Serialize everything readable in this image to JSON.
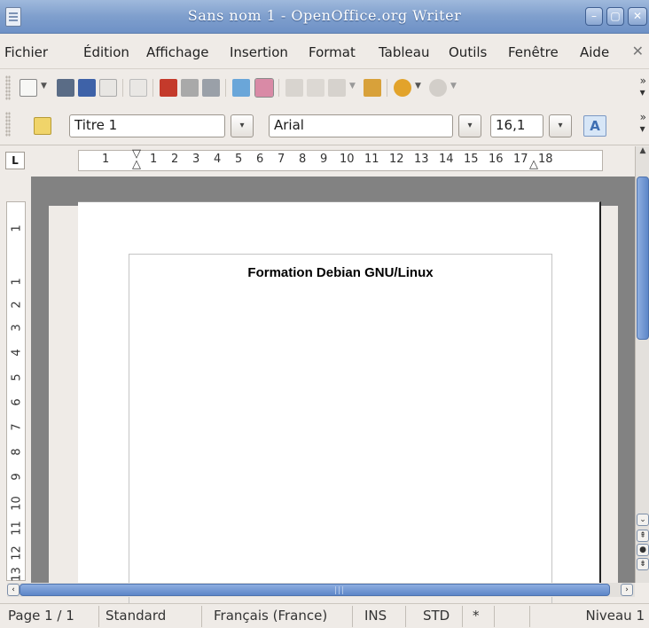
{
  "window": {
    "title": "Sans nom 1 - OpenOffice.org Writer"
  },
  "menu": {
    "items": [
      "Fichier",
      "Édition",
      "Affichage",
      "Insertion",
      "Format",
      "Tableau",
      "Outils",
      "Fenêtre",
      "Aide"
    ],
    "close": "✕"
  },
  "formatting": {
    "paragraph_style": "Titre 1",
    "font_name": "Arial",
    "font_size": "16,1"
  },
  "ruler": {
    "corner": "L",
    "horizontal_ticks": [
      "1",
      "1",
      "2",
      "3",
      "4",
      "5",
      "6",
      "7",
      "8",
      "9",
      "10",
      "11",
      "12",
      "13",
      "14",
      "15",
      "16",
      "17",
      "18"
    ],
    "vertical_ticks": [
      "1",
      "1",
      "2",
      "3",
      "4",
      "5",
      "6",
      "7",
      "8",
      "9",
      "10",
      "11",
      "12",
      "13"
    ]
  },
  "document": {
    "heading": "Formation Debian GNU/Linux"
  },
  "status": {
    "page": "Page 1 / 1",
    "page_style": "Standard",
    "language": "Français (France)",
    "insert_mode": "INS",
    "selection_mode": "STD",
    "modified": "*",
    "level": "Niveau 1"
  },
  "colors": {
    "titlebar": "#7f9fcd",
    "scroll_thumb": "#5d86c8",
    "canvas": "#828282"
  }
}
